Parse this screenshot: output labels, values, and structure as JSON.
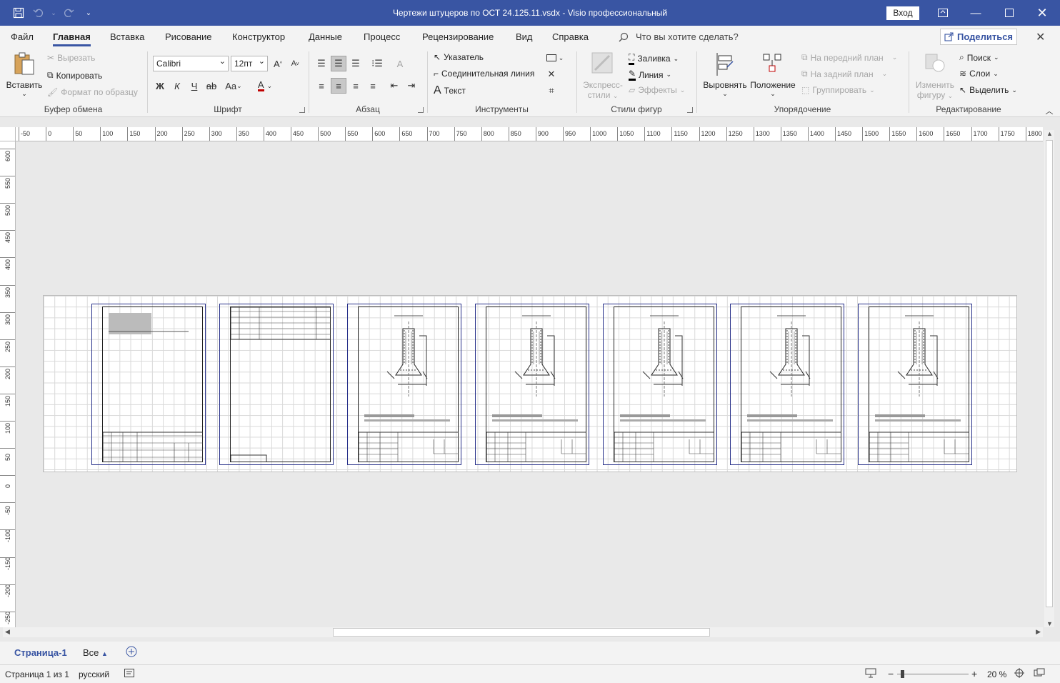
{
  "titlebar": {
    "title": "Чертежи штуцеров по ОСТ 24.125.11.vsdx  -  Visio профессиональный",
    "signin_label": "Вход"
  },
  "tabs": {
    "file": "Файл",
    "home": "Главная",
    "insert": "Вставка",
    "draw": "Рисование",
    "design": "Конструктор",
    "data": "Данные",
    "process": "Процесс",
    "review": "Рецензирование",
    "view": "Вид",
    "help": "Справка",
    "tellme": "Что вы хотите сделать?",
    "share": "Поделиться"
  },
  "ribbon": {
    "clipboard": {
      "label": "Буфер обмена",
      "paste": "Вставить",
      "cut": "Вырезать",
      "copy": "Копировать",
      "format_painter": "Формат по образцу"
    },
    "font": {
      "label": "Шрифт",
      "family": "Calibri",
      "size": "12пт",
      "bold": "Ж",
      "italic": "К",
      "underline": "Ч",
      "strike": "ab",
      "case": "Aa",
      "color": "A"
    },
    "paragraph": {
      "label": "Абзац"
    },
    "tools": {
      "label": "Инструменты",
      "pointer": "Указатель",
      "connector": "Соединительная линия",
      "text": "Текст"
    },
    "shape_styles": {
      "label": "Стили фигур",
      "quick_styles_1": "Экспресс-",
      "quick_styles_2": "стили",
      "fill": "Заливка",
      "line": "Линия",
      "effects": "Эффекты"
    },
    "arrange": {
      "label": "Упорядочение",
      "align": "Выровнять",
      "position": "Положение",
      "bring_front": "На передний план",
      "send_back": "На задний план",
      "group": "Группировать"
    },
    "editing": {
      "label": "Редактирование",
      "change_shape_1": "Изменить",
      "change_shape_2": "фигуру",
      "find": "Поиск",
      "layers": "Слои",
      "select": "Выделить"
    }
  },
  "ruler": {
    "h_labels": [
      "-50",
      "0",
      "50",
      "100",
      "150",
      "200",
      "250",
      "300",
      "350",
      "400",
      "450",
      "500",
      "550",
      "600",
      "650",
      "700",
      "750",
      "800",
      "850",
      "900",
      "950",
      "1000",
      "1050",
      "1100",
      "1150",
      "1200",
      "1250",
      "1300",
      "1350",
      "1400",
      "1450",
      "1500",
      "1550",
      "1600",
      "1650",
      "1700",
      "1750",
      "1800"
    ],
    "v_labels": [
      "600",
      "550",
      "500",
      "450",
      "400",
      "350",
      "300",
      "250",
      "200",
      "150",
      "100",
      "50",
      "0",
      "-50",
      "-100",
      "-150",
      "-200",
      "-250"
    ]
  },
  "pagetabs": {
    "page1": "Страница-1",
    "all": "Все"
  },
  "status": {
    "page_info": "Страница 1 из 1",
    "language": "русский",
    "zoom": "20 %"
  }
}
